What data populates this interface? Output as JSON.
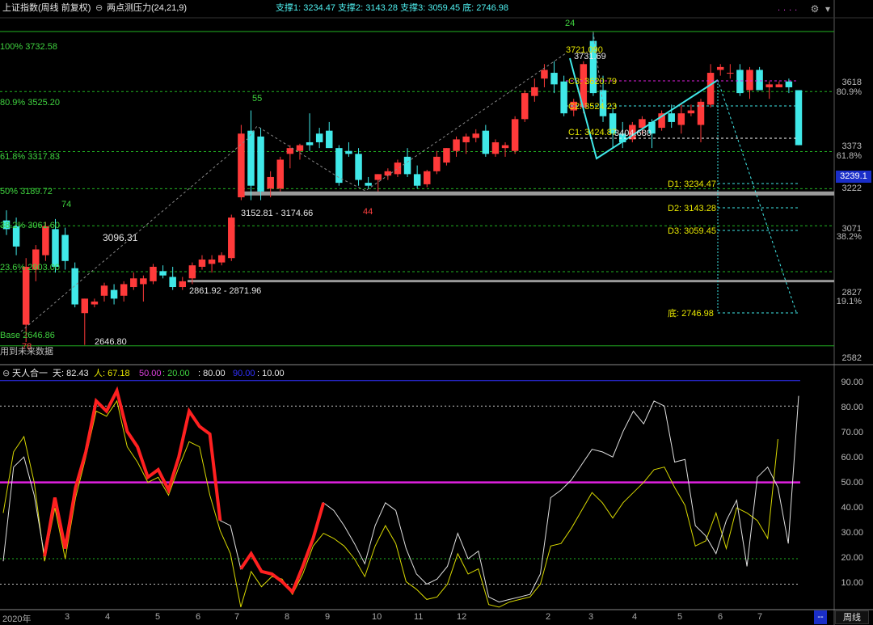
{
  "header": {
    "index_name": "上证指数(周线 前复权)",
    "indicator_name": "两点测压力(24,21,9)",
    "support_line": "支撑1: 3234.47  支撑2: 3143.28  支撑3: 3059.45  底: 2746.98"
  },
  "price_axis": [
    "3618",
    "3373",
    "3222",
    "3071",
    "2827",
    "2582"
  ],
  "pct_axis": [
    "80.9%",
    "61.8%",
    "38.2%",
    "19.1%"
  ],
  "current_price": "3239.1",
  "indicator_axis": [
    "90.00",
    "80.00",
    "70.00",
    "60.00",
    "50.00",
    "40.00",
    "30.00",
    "20.00",
    "10.00"
  ],
  "fib_labels": {
    "f100": "100% 3732.58",
    "f809": "80.9% 3525.20",
    "f618": "61.8% 3317.83",
    "f50": "50% 3189.72",
    "f382": "38.2% 3061.60",
    "f236": "23.6% 2903.00",
    "base": "Base 2646.86"
  },
  "annotations": {
    "n24": "24",
    "n55": "55",
    "n74": "74",
    "n44": "44",
    "n78": "78",
    "v3096": "3096.31",
    "range1": "3152.81 - 3174.66",
    "range2": "2861.92 - 2871.96",
    "low": "2646.80",
    "future": "用到未来数据",
    "peak1": "3721.090",
    "peak2": "3731.69",
    "c3": "C3: 3620.79",
    "c2": "C2: 3524.23",
    "c1": "C1: 3424.87",
    "c1b": "3404.680",
    "d1": "D1: 3234.47",
    "d2": "D2: 3143.28",
    "d3": "D3: 3059.45",
    "bottom": "底: 2746.98"
  },
  "indicator_header": {
    "name": "天人合一",
    "tian": "天: 82.43",
    "ren": "人: 67.18",
    "v50": "50.00",
    "v20": ": 20.00",
    "v80": ": 80.00",
    "v90": "90.00",
    "v10": ": 10.00"
  },
  "months": [
    "2020年",
    "3",
    "4",
    "5",
    "6",
    "7",
    "8",
    "9",
    "10",
    "11",
    "12",
    "2",
    "3",
    "4",
    "5",
    "6",
    "7"
  ],
  "bottom_bar": {
    "dash_button": "--",
    "period_button": "周线"
  },
  "colors": {
    "up": "#ff3a3a",
    "down": "#40e8e8",
    "fib": "#22b422",
    "magenta": "#e020e0",
    "yellow_line": "#d8d800",
    "white_line": "#e0e0e0"
  },
  "chart_data": {
    "type": "candlestick",
    "candles": [
      {
        "o": 3080,
        "h": 3115,
        "l": 3030,
        "c": 3050
      },
      {
        "o": 3060,
        "h": 3090,
        "l": 2960,
        "c": 2990
      },
      {
        "o": 2720,
        "h": 2950,
        "l": 2660,
        "c": 2920
      },
      {
        "o": 2910,
        "h": 2995,
        "l": 2870,
        "c": 2980
      },
      {
        "o": 2960,
        "h": 3075,
        "l": 2940,
        "c": 3060
      },
      {
        "o": 3050,
        "h": 3085,
        "l": 2900,
        "c": 2920
      },
      {
        "o": 3030,
        "h": 3055,
        "l": 2910,
        "c": 2940
      },
      {
        "o": 2915,
        "h": 2935,
        "l": 2780,
        "c": 2790
      },
      {
        "o": 2760,
        "h": 2810,
        "l": 2650,
        "c": 2810
      },
      {
        "o": 2790,
        "h": 2810,
        "l": 2780,
        "c": 2800
      },
      {
        "o": 2820,
        "h": 2865,
        "l": 2800,
        "c": 2855
      },
      {
        "o": 2840,
        "h": 2860,
        "l": 2790,
        "c": 2810
      },
      {
        "o": 2820,
        "h": 2870,
        "l": 2800,
        "c": 2860
      },
      {
        "o": 2850,
        "h": 2900,
        "l": 2840,
        "c": 2880
      },
      {
        "o": 2860,
        "h": 2890,
        "l": 2800,
        "c": 2880
      },
      {
        "o": 2870,
        "h": 2930,
        "l": 2860,
        "c": 2920
      },
      {
        "o": 2905,
        "h": 2925,
        "l": 2880,
        "c": 2890
      },
      {
        "o": 2885,
        "h": 2920,
        "l": 2840,
        "c": 2850
      },
      {
        "o": 2850,
        "h": 2885,
        "l": 2840,
        "c": 2870
      },
      {
        "o": 2880,
        "h": 2935,
        "l": 2860,
        "c": 2925
      },
      {
        "o": 2920,
        "h": 2960,
        "l": 2910,
        "c": 2945
      },
      {
        "o": 2930,
        "h": 2960,
        "l": 2900,
        "c": 2945
      },
      {
        "o": 2935,
        "h": 2970,
        "l": 2925,
        "c": 2960
      },
      {
        "o": 2950,
        "h": 3100,
        "l": 2940,
        "c": 3090
      },
      {
        "o": 3160,
        "h": 3410,
        "l": 3150,
        "c": 3380
      },
      {
        "o": 3390,
        "h": 3460,
        "l": 3150,
        "c": 3200
      },
      {
        "o": 3370,
        "h": 3400,
        "l": 3150,
        "c": 3180
      },
      {
        "o": 3190,
        "h": 3250,
        "l": 3160,
        "c": 3230
      },
      {
        "o": 3190,
        "h": 3300,
        "l": 3180,
        "c": 3290
      },
      {
        "o": 3310,
        "h": 3340,
        "l": 3260,
        "c": 3330
      },
      {
        "o": 3320,
        "h": 3345,
        "l": 3290,
        "c": 3340
      },
      {
        "o": 3350,
        "h": 3450,
        "l": 3320,
        "c": 3340
      },
      {
        "o": 3380,
        "h": 3400,
        "l": 3330,
        "c": 3350
      },
      {
        "o": 3390,
        "h": 3420,
        "l": 3340,
        "c": 3330
      },
      {
        "o": 3330,
        "h": 3340,
        "l": 3200,
        "c": 3210
      },
      {
        "o": 3320,
        "h": 3350,
        "l": 3300,
        "c": 3310
      },
      {
        "o": 3310,
        "h": 3330,
        "l": 3200,
        "c": 3220
      },
      {
        "o": 3210,
        "h": 3230,
        "l": 3190,
        "c": 3200
      },
      {
        "o": 3220,
        "h": 3240,
        "l": 3180,
        "c": 3240
      },
      {
        "o": 3235,
        "h": 3260,
        "l": 3220,
        "c": 3250
      },
      {
        "o": 3240,
        "h": 3290,
        "l": 3230,
        "c": 3280
      },
      {
        "o": 3300,
        "h": 3330,
        "l": 3230,
        "c": 3240
      },
      {
        "o": 3240,
        "h": 3270,
        "l": 3190,
        "c": 3200
      },
      {
        "o": 3205,
        "h": 3255,
        "l": 3195,
        "c": 3250
      },
      {
        "o": 3250,
        "h": 3320,
        "l": 3240,
        "c": 3300
      },
      {
        "o": 3280,
        "h": 3330,
        "l": 3270,
        "c": 3330
      },
      {
        "o": 3320,
        "h": 3370,
        "l": 3300,
        "c": 3360
      },
      {
        "o": 3350,
        "h": 3380,
        "l": 3310,
        "c": 3370
      },
      {
        "o": 3365,
        "h": 3395,
        "l": 3350,
        "c": 3380
      },
      {
        "o": 3390,
        "h": 3410,
        "l": 3300,
        "c": 3310
      },
      {
        "o": 3310,
        "h": 3360,
        "l": 3300,
        "c": 3350
      },
      {
        "o": 3330,
        "h": 3350,
        "l": 3300,
        "c": 3340
      },
      {
        "o": 3320,
        "h": 3440,
        "l": 3310,
        "c": 3430
      },
      {
        "o": 3430,
        "h": 3530,
        "l": 3420,
        "c": 3520
      },
      {
        "o": 3510,
        "h": 3570,
        "l": 3490,
        "c": 3540
      },
      {
        "o": 3570,
        "h": 3620,
        "l": 3540,
        "c": 3600
      },
      {
        "o": 3590,
        "h": 3630,
        "l": 3520,
        "c": 3550
      },
      {
        "o": 3560,
        "h": 3580,
        "l": 3440,
        "c": 3450
      },
      {
        "o": 3460,
        "h": 3500,
        "l": 3440,
        "c": 3490
      },
      {
        "o": 3470,
        "h": 3630,
        "l": 3450,
        "c": 3620
      },
      {
        "o": 3700,
        "h": 3731,
        "l": 3510,
        "c": 3520
      },
      {
        "o": 3530,
        "h": 3580,
        "l": 3420,
        "c": 3440
      },
      {
        "o": 3450,
        "h": 3470,
        "l": 3330,
        "c": 3380
      },
      {
        "o": 3380,
        "h": 3420,
        "l": 3330,
        "c": 3350
      },
      {
        "o": 3360,
        "h": 3420,
        "l": 3350,
        "c": 3410
      },
      {
        "o": 3400,
        "h": 3440,
        "l": 3380,
        "c": 3430
      },
      {
        "o": 3420,
        "h": 3430,
        "l": 3330,
        "c": 3380
      },
      {
        "o": 3400,
        "h": 3460,
        "l": 3390,
        "c": 3450
      },
      {
        "o": 3450,
        "h": 3480,
        "l": 3400,
        "c": 3420
      },
      {
        "o": 3410,
        "h": 3480,
        "l": 3380,
        "c": 3450
      },
      {
        "o": 3450,
        "h": 3480,
        "l": 3440,
        "c": 3460
      },
      {
        "o": 3410,
        "h": 3500,
        "l": 3350,
        "c": 3490
      },
      {
        "o": 3480,
        "h": 3620,
        "l": 3470,
        "c": 3590
      },
      {
        "o": 3600,
        "h": 3620,
        "l": 3580,
        "c": 3610
      },
      {
        "o": 3590,
        "h": 3620,
        "l": 3570,
        "c": 3590
      },
      {
        "o": 3600,
        "h": 3620,
        "l": 3510,
        "c": 3520
      },
      {
        "o": 3530,
        "h": 3610,
        "l": 3500,
        "c": 3600
      },
      {
        "o": 3600,
        "h": 3610,
        "l": 3530,
        "c": 3530
      },
      {
        "o": 3540,
        "h": 3560,
        "l": 3500,
        "c": 3550
      },
      {
        "o": 3540,
        "h": 3560,
        "l": 3540,
        "c": 3550
      },
      {
        "o": 3560,
        "h": 3570,
        "l": 3520,
        "c": 3540
      },
      {
        "o": 3530,
        "h": 3530,
        "l": 3340,
        "c": 3340
      }
    ],
    "indicator_white": [
      19,
      56,
      60,
      45,
      21,
      44,
      24,
      48,
      62,
      82,
      78,
      86,
      70,
      64,
      52,
      55,
      47,
      60,
      78,
      72,
      69,
      35,
      33,
      16,
      22,
      15,
      14,
      11,
      7,
      17,
      28,
      42,
      39,
      33,
      26,
      18,
      33,
      42,
      39,
      24,
      14,
      10,
      12,
      17,
      30,
      20,
      23,
      5,
      3,
      4,
      5,
      6,
      14,
      44,
      47,
      51,
      57,
      63,
      62,
      60,
      70,
      78,
      73,
      82,
      80,
      58,
      59,
      33,
      29,
      22,
      35,
      43,
      17,
      52,
      56,
      48,
      26,
      84
    ],
    "indicator_yellow": [
      38,
      62,
      68,
      50,
      19,
      40,
      20,
      44,
      60,
      78,
      76,
      82,
      64,
      58,
      50,
      52,
      45,
      56,
      66,
      64,
      45,
      31,
      22,
      1,
      15,
      9,
      13,
      12,
      6,
      14,
      25,
      30,
      28,
      25,
      20,
      13,
      25,
      33,
      26,
      11,
      8,
      4,
      5,
      10,
      22,
      14,
      16,
      2,
      1,
      3,
      4,
      5,
      10,
      25,
      26,
      32,
      39,
      46,
      42,
      36,
      42,
      46,
      50,
      55,
      56,
      48,
      41,
      25,
      27,
      38,
      24,
      40,
      38,
      35,
      28,
      67
    ],
    "ylim_price": [
      2582,
      3780
    ],
    "ylim_indicator": [
      0,
      95
    ]
  }
}
